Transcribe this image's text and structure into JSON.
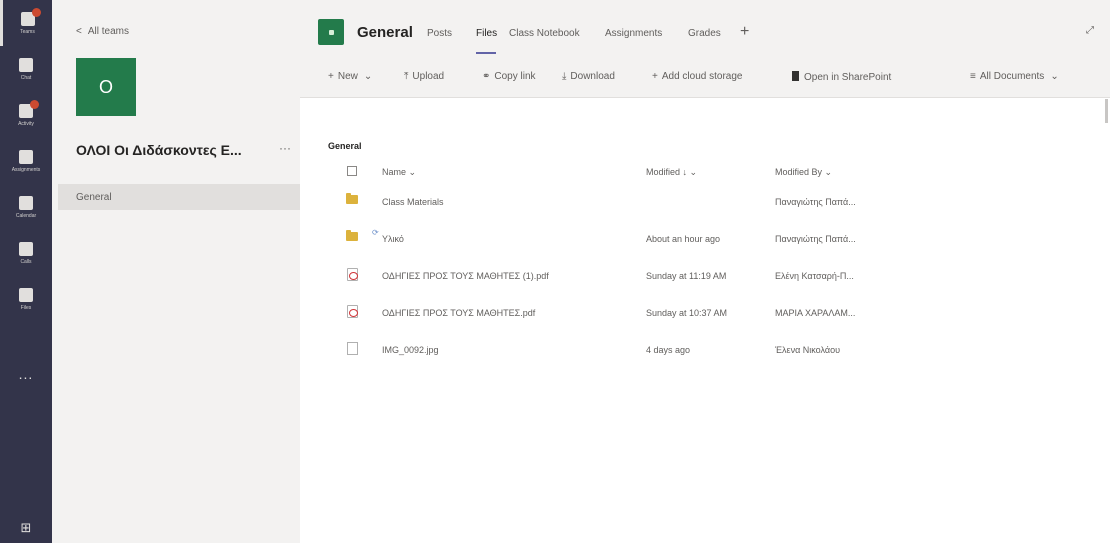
{
  "rail": {
    "items": [
      {
        "label": "Teams",
        "icon": "teams-icon",
        "badge": true
      },
      {
        "label": "Chat",
        "icon": "chat-icon",
        "badge": false
      },
      {
        "label": "Activity",
        "icon": "bell-icon",
        "badge": true
      },
      {
        "label": "Assignments",
        "icon": "assignments-icon",
        "badge": false
      },
      {
        "label": "Calendar",
        "icon": "calendar-icon",
        "badge": false
      },
      {
        "label": "Calls",
        "icon": "phone-icon",
        "badge": false
      },
      {
        "label": "Files",
        "icon": "file-icon",
        "badge": false
      }
    ],
    "more": "...",
    "apps": "⊞"
  },
  "sidebar": {
    "back": "All teams",
    "avatar_letter": "O",
    "team_name": "ΟΛΟΙ Οι Διδάσκοντες Ε...",
    "more": "···",
    "channel": "General"
  },
  "header": {
    "title": "General",
    "tabs": [
      "Posts",
      "Files",
      "Class Notebook",
      "Assignments",
      "Grades"
    ],
    "active_tab": "Files",
    "add": "+",
    "expand": "⤢"
  },
  "toolbar": {
    "new": "New",
    "upload": "Upload",
    "copy_link": "Copy link",
    "download": "Download",
    "add_cloud": "Add cloud storage",
    "open_sharepoint": "Open in SharePoint",
    "all_documents": "All Documents"
  },
  "content": {
    "breadcrumb": "General",
    "columns": {
      "name": "Name ⌄",
      "modified": "Modified ↓ ⌄",
      "modified_by": "Modified By ⌄"
    },
    "files": [
      {
        "type": "folder",
        "name": "Class Materials",
        "modified": "",
        "modified_by": "Παναγιώτης Παπά..."
      },
      {
        "type": "folder",
        "name": "Υλικό",
        "modified": "About an hour ago",
        "modified_by": "Παναγιώτης Παπά..."
      },
      {
        "type": "pdf",
        "name": "ΟΔΗΓΙΕΣ ΠΡΟΣ ΤΟΥΣ ΜΑΘΗΤΕΣ (1).pdf",
        "modified": "Sunday at 11:19 AM",
        "modified_by": "Ελένη Κατσαρή-Π..."
      },
      {
        "type": "pdf",
        "name": "ΟΔΗΓΙΕΣ ΠΡΟΣ ΤΟΥΣ ΜΑΘΗΤΕΣ.pdf",
        "modified": "Sunday at 10:37 AM",
        "modified_by": "ΜΑΡΙΑ ΧΑΡΑΛΑΜ..."
      },
      {
        "type": "image",
        "name": "IMG_0092.jpg",
        "modified": "4 days ago",
        "modified_by": "Έλενα Νικολάου"
      }
    ]
  }
}
